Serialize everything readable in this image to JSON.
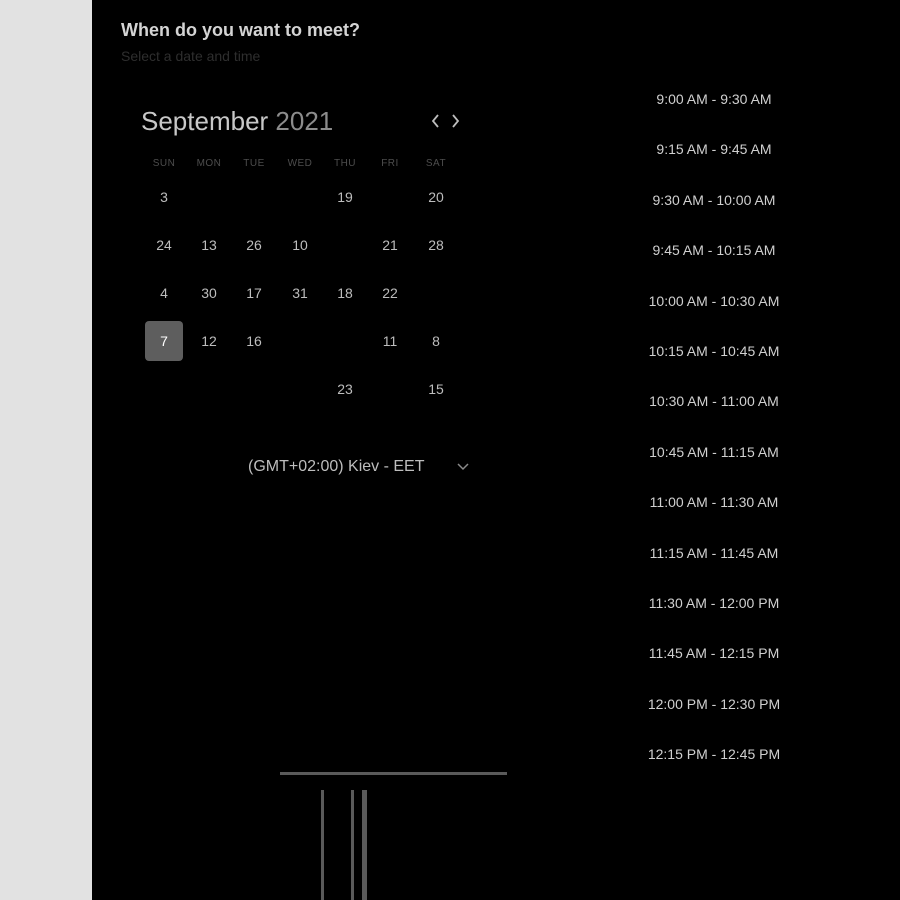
{
  "header": {
    "title": "When do you want to meet?",
    "subtitle": "Select a date and time"
  },
  "calendar": {
    "month": "September",
    "year": "2021",
    "prev_icon": "chevron-left-icon",
    "next_icon": "chevron-right-icon",
    "weekdays": [
      "SUN",
      "MON",
      "TUE",
      "WED",
      "THU",
      "FRI",
      "SAT"
    ],
    "weeks": [
      [
        "3",
        "",
        "",
        "",
        "19",
        "",
        "20"
      ],
      [
        "24",
        "13",
        "26",
        "10",
        "",
        "21",
        "28"
      ],
      [
        "4",
        "30",
        "17",
        "31",
        "18",
        "22",
        ""
      ],
      [
        "7",
        "12",
        "16",
        "",
        "",
        "11",
        "8"
      ],
      [
        "",
        "",
        "",
        "",
        "23",
        "",
        "15"
      ]
    ],
    "selected_day": "7",
    "selected_color": "#5e5e5e"
  },
  "timezone": {
    "label": "(GMT+02:00) Kiev - EET",
    "icon": "chevron-down-icon"
  },
  "time_slots": [
    "9:00 AM - 9:30 AM",
    "9:15 AM - 9:45 AM",
    "9:30 AM - 10:00 AM",
    "9:45 AM - 10:15 AM",
    "10:00 AM - 10:30 AM",
    "10:15 AM - 10:45 AM",
    "10:30 AM - 11:00 AM",
    "10:45 AM - 11:15 AM",
    "11:00 AM - 11:30 AM",
    "11:15 AM - 11:45 AM",
    "11:30 AM - 12:00 PM",
    "11:45 AM - 12:15 PM",
    "12:00 PM - 12:30 PM",
    "12:15 PM - 12:45 PM"
  ]
}
